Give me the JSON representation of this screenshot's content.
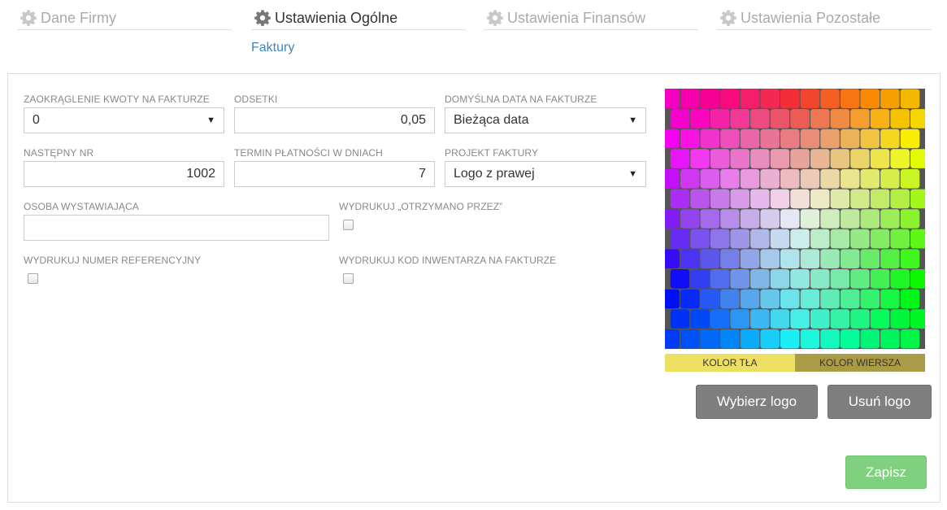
{
  "tabs": [
    {
      "label": "Dane Firmy"
    },
    {
      "label": "Ustawienia Ogólne"
    },
    {
      "label": "Ustawienia Finansów"
    },
    {
      "label": "Ustawienia Pozostałe"
    }
  ],
  "subtab": {
    "label": "Faktury"
  },
  "form": {
    "rounding": {
      "label": "ZAOKRĄGLENIE KWOTY NA FAKTURZE",
      "value": "0"
    },
    "interest": {
      "label": "ODSETKI",
      "value": "0,05"
    },
    "default_date": {
      "label": "DOMYŚLNA DATA NA FAKTURZE",
      "value": "Bieżąca data"
    },
    "next_nr": {
      "label": "NASTĘPNY NR",
      "value": "1002"
    },
    "payment_days": {
      "label": "TERMIN PŁATNOŚCI W DNIACH",
      "value": "7"
    },
    "invoice_design": {
      "label": "PROJEKT FAKTURY",
      "value": "Logo z prawej"
    },
    "issuer": {
      "label": "OSOBA WYSTAWIAJĄCA",
      "value": ""
    },
    "print_received": {
      "label": "WYDRUKUJ „OTRZYMANO PRZEZ”",
      "checked": false
    },
    "print_reference": {
      "label": "WYDRUKUJ NUMER REFERENCYJNY",
      "checked": false
    },
    "print_inventory": {
      "label": "WYDRUKUJ KOD INWENTARZA NA FAKTURZE",
      "checked": false
    }
  },
  "colors": {
    "background": {
      "label": "KOLOR TŁA",
      "hex": "#ecdf62"
    },
    "row": {
      "label": "KOLOR WIERSZA",
      "hex": "#aa9c46"
    },
    "accent_link": "#3a87c8",
    "save_green": "#7fd07f",
    "button_grey": "#7f7f7f"
  },
  "buttons": {
    "choose_logo": "Wybierz logo",
    "remove_logo": "Usuń logo",
    "save": "Zapisz"
  }
}
